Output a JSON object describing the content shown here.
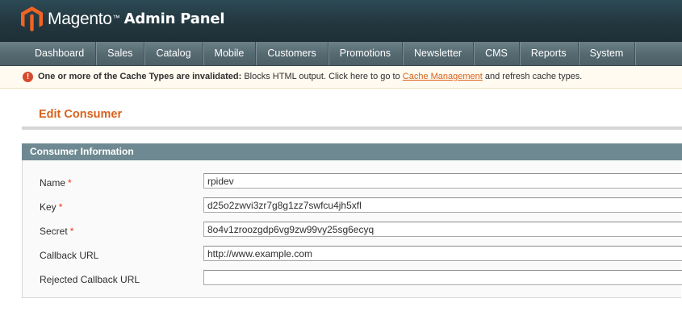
{
  "header": {
    "brand": "Magento",
    "trademark": "™",
    "title": "Admin Panel",
    "logo_icon": "magento-logo-icon"
  },
  "nav": {
    "items": [
      "Dashboard",
      "Sales",
      "Catalog",
      "Mobile",
      "Customers",
      "Promotions",
      "Newsletter",
      "CMS",
      "Reports",
      "System"
    ]
  },
  "notice": {
    "icon": "error-icon",
    "bold_text": "One or more of the Cache Types are invalidated:",
    "text_before_link": " Blocks HTML output. Click here to go to ",
    "link_text": "Cache Management",
    "text_after_link": " and refresh cache types."
  },
  "page": {
    "title": "Edit Consumer"
  },
  "section": {
    "title": "Consumer Information",
    "fields": [
      {
        "label": "Name",
        "required": true,
        "value": "rpidev"
      },
      {
        "label": "Key",
        "required": true,
        "value": "d25o2zwvi3zr7g8g1zz7swfcu4jh5xfl"
      },
      {
        "label": "Secret",
        "required": true,
        "value": "8o4v1zroozgdp6vg9zw99vy25sg6ecyq"
      },
      {
        "label": "Callback URL",
        "required": false,
        "value": "http://www.example.com"
      },
      {
        "label": "Rejected Callback URL",
        "required": false,
        "value": ""
      }
    ],
    "required_mark": "*"
  },
  "colors": {
    "accent": "#d8611c",
    "required": "#eb340a",
    "header_bg": "#22353d",
    "nav_bg": "#566a72",
    "section_head_bg": "#6f8992"
  }
}
